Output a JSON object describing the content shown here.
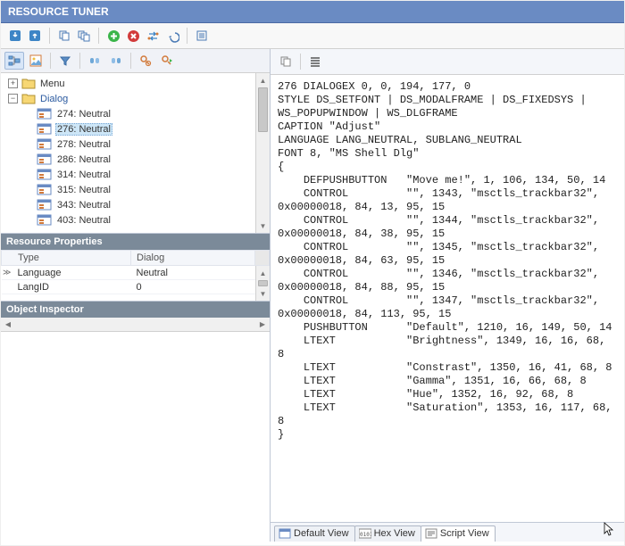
{
  "app_title": "RESOURCE TUNER",
  "tree": {
    "root_name": "Menu",
    "dialog_name": "Dialog",
    "items": [
      {
        "id": "274",
        "label": "274: Neutral"
      },
      {
        "id": "276",
        "label": "276: Neutral"
      },
      {
        "id": "278",
        "label": "278: Neutral"
      },
      {
        "id": "286",
        "label": "286: Neutral"
      },
      {
        "id": "314",
        "label": "314: Neutral"
      },
      {
        "id": "315",
        "label": "315: Neutral"
      },
      {
        "id": "343",
        "label": "343: Neutral"
      },
      {
        "id": "403",
        "label": "403: Neutral"
      }
    ],
    "selected_id": "276"
  },
  "panels": {
    "properties_header": "Resource Properties",
    "inspector_header": "Object Inspector"
  },
  "properties": {
    "col1": "Type",
    "col1_value": "Dialog",
    "rows": [
      {
        "k": "Language",
        "v": "Neutral"
      },
      {
        "k": "LangID",
        "v": "0"
      }
    ]
  },
  "tabs": [
    {
      "id": "default",
      "label": "Default View"
    },
    {
      "id": "hex",
      "label": "Hex View"
    },
    {
      "id": "script",
      "label": "Script View"
    }
  ],
  "active_tab": "script",
  "script": "276 DIALOGEX 0, 0, 194, 177, 0\nSTYLE DS_SETFONT | DS_MODALFRAME | DS_FIXEDSYS | WS_POPUPWINDOW | WS_DLGFRAME\nCAPTION \"Adjust\"\nLANGUAGE LANG_NEUTRAL, SUBLANG_NEUTRAL\nFONT 8, \"MS Shell Dlg\"\n{\n    DEFPUSHBUTTON   \"Move me!\", 1, 106, 134, 50, 14\n    CONTROL         \"\", 1343, \"msctls_trackbar32\", 0x00000018, 84, 13, 95, 15\n    CONTROL         \"\", 1344, \"msctls_trackbar32\", 0x00000018, 84, 38, 95, 15\n    CONTROL         \"\", 1345, \"msctls_trackbar32\", 0x00000018, 84, 63, 95, 15\n    CONTROL         \"\", 1346, \"msctls_trackbar32\", 0x00000018, 84, 88, 95, 15\n    CONTROL         \"\", 1347, \"msctls_trackbar32\", 0x00000018, 84, 113, 95, 15\n    PUSHBUTTON      \"Default\", 1210, 16, 149, 50, 14\n    LTEXT           \"Brightness\", 1349, 16, 16, 68, 8\n    LTEXT           \"Constrast\", 1350, 16, 41, 68, 8\n    LTEXT           \"Gamma\", 1351, 16, 66, 68, 8\n    LTEXT           \"Hue\", 1352, 16, 92, 68, 8\n    LTEXT           \"Saturation\", 1353, 16, 117, 68, 8\n}"
}
